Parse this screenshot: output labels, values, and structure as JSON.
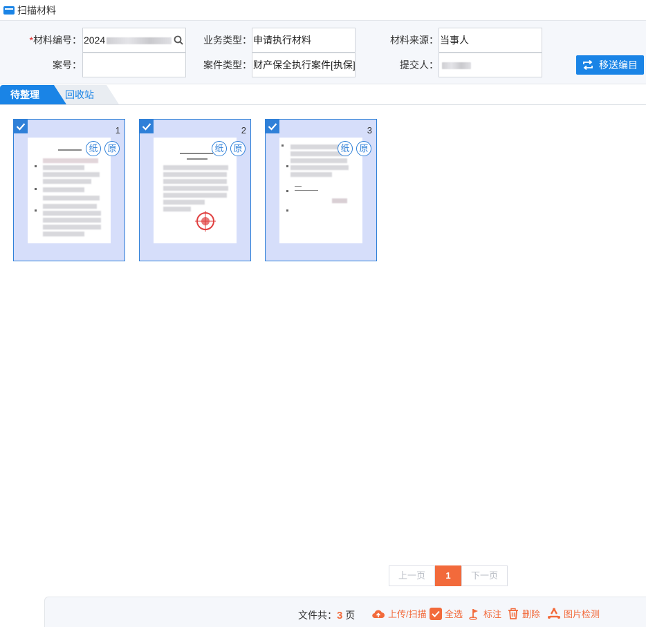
{
  "window": {
    "title": "扫描材料"
  },
  "form": {
    "material_no_label": "材料编号：",
    "material_no_required": "*",
    "material_no_value": "2024",
    "business_type_label": "业务类型：",
    "business_type_value": "申请执行材料",
    "source_label": "材料来源：",
    "source_value": "当事人",
    "case_no_label": "案号：",
    "case_no_value": "",
    "case_type_label": "案件类型：",
    "case_type_value": "财产保全执行案件[执保]",
    "submitter_label": "提交人：",
    "submitter_value": "",
    "move_button": "移送编目"
  },
  "tabs": [
    {
      "label": "待整理",
      "active": true
    },
    {
      "label": "回收站",
      "active": false
    }
  ],
  "cards": [
    {
      "number": "1",
      "badges": [
        "纸",
        "原"
      ],
      "selected": true
    },
    {
      "number": "2",
      "badges": [
        "纸",
        "原"
      ],
      "selected": true
    },
    {
      "number": "3",
      "badges": [
        "纸",
        "原"
      ],
      "selected": true
    }
  ],
  "pagination": {
    "prev": "上一页",
    "current": "1",
    "next": "下一页"
  },
  "footer": {
    "total_prefix": "文件共：",
    "total_count": "3",
    "total_suffix": " 页",
    "upload": "上传/扫描",
    "select_all": "全选",
    "annotate": "标注",
    "delete": "删除",
    "image_check": "图片检测"
  },
  "colors": {
    "primary": "#1a84e6",
    "accent": "#f26a3b",
    "card_bg": "#d6defa"
  }
}
